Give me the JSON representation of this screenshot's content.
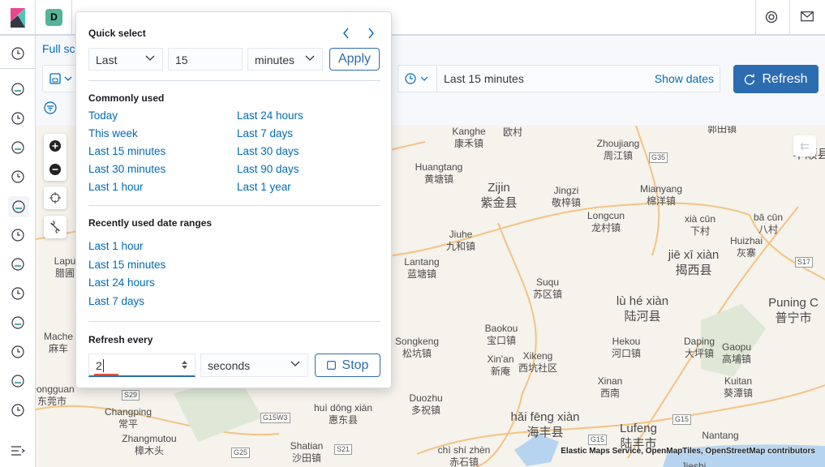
{
  "header": {
    "avatar_letter": "D",
    "help_icon": "help-lifebuoy-icon",
    "mail_icon": "mail-icon"
  },
  "sidebar": {
    "items": [
      "recently-viewed",
      "discover",
      "visualize",
      "dashboard",
      "canvas",
      "maps",
      "machine-learning",
      "metrics",
      "logs",
      "apm",
      "uptime",
      "graph",
      "dev-tools",
      "collapse"
    ]
  },
  "toolbar": {
    "full_screen": "Full screen",
    "date_text": "Last 15 minutes",
    "show_dates": "Show dates",
    "refresh_label": "Refresh"
  },
  "popover": {
    "quick_select": {
      "title": "Quick select",
      "direction": "Last",
      "value": "15",
      "unit": "minutes",
      "apply": "Apply"
    },
    "commonly_used": {
      "title": "Commonly used",
      "col1": [
        "Today",
        "This week",
        "Last 15 minutes",
        "Last 30 minutes",
        "Last 1 hour"
      ],
      "col2": [
        "Last 24 hours",
        "Last 7 days",
        "Last 30 days",
        "Last 90 days",
        "Last 1 year"
      ]
    },
    "recent": {
      "title": "Recently used date ranges",
      "items": [
        "Last 1 hour",
        "Last 15 minutes",
        "Last 24 hours",
        "Last 7 days"
      ]
    },
    "refresh": {
      "title": "Refresh every",
      "value": "2",
      "unit": "seconds",
      "stop": "Stop"
    }
  },
  "map": {
    "labels": [
      {
        "en": "Lapu",
        "zh": "腊圃"
      },
      {
        "en": "Mache",
        "zh": "麻车"
      },
      {
        "en": "Dongguan",
        "zh": "东莞市"
      },
      {
        "en": "Changping",
        "zh": "常平"
      },
      {
        "en": "Zhangmutou",
        "zh": "樟木头"
      },
      {
        "en": "huì dōng xiàn",
        "zh": "惠东县"
      },
      {
        "en": "Shatian",
        "zh": "沙田镇"
      },
      {
        "en": "Kanghe",
        "zh": "康禾镇"
      },
      {
        "en": "",
        "zh": "欧村"
      },
      {
        "en": "",
        "zh": "郭田镇"
      },
      {
        "en": "Zhoujiang",
        "zh": "周江镇"
      },
      {
        "en": "Huangtang",
        "zh": "黄塘镇"
      },
      {
        "en": "Zijin",
        "zh": "紫金县"
      },
      {
        "en": "Jingzi",
        "zh": "敬梓镇"
      },
      {
        "en": "Mianyang",
        "zh": "棉洋镇"
      },
      {
        "en": "Longcun",
        "zh": "龙村镇"
      },
      {
        "en": "xià cūn",
        "zh": "下村"
      },
      {
        "en": "bā cūn",
        "zh": "八村"
      },
      {
        "en": "Huizhai",
        "zh": "灰寨"
      },
      {
        "en": "jiē xī xiàn",
        "zh": "揭西县"
      },
      {
        "en": "Jiuhe",
        "zh": "九和镇"
      },
      {
        "en": "Lantang",
        "zh": "蓝塘镇"
      },
      {
        "en": "Suqu",
        "zh": "苏区镇"
      },
      {
        "en": "lù hé xiàn",
        "zh": "陆河县"
      },
      {
        "en": "Puning C",
        "zh": "普宁市"
      },
      {
        "en": "Baokou",
        "zh": "宝口镇"
      },
      {
        "en": "Songkeng",
        "zh": "松坑镇"
      },
      {
        "en": "Hekou",
        "zh": "河口镇"
      },
      {
        "en": "Daping",
        "zh": "大坪镇"
      },
      {
        "en": "Gaopu",
        "zh": "高埔镇"
      },
      {
        "en": "Xin'an",
        "zh": "新庵"
      },
      {
        "en": "Xikeng",
        "zh": "西坑社区"
      },
      {
        "en": "Xinan",
        "zh": "西南"
      },
      {
        "en": "Kuitan",
        "zh": "葵潭镇"
      },
      {
        "en": "Duozhu",
        "zh": "多祝镇"
      },
      {
        "en": "hǎi fēng xiàn",
        "zh": "海丰县"
      },
      {
        "en": "Lufeng",
        "zh": "陆丰市"
      },
      {
        "en": "Nantang",
        "zh": ""
      },
      {
        "en": "chì shí zhèn",
        "zh": "赤石镇"
      },
      {
        "en": "Jieshi",
        "zh": ""
      },
      {
        "en": "",
        "zh": "丰顺县"
      }
    ],
    "shields": [
      "G35",
      "S17",
      "G15",
      "G15",
      "S29",
      "G15W3",
      "G25",
      "S21"
    ],
    "attribution": "Elastic Maps Service, OpenMapTiles, OpenStreetMap contributors"
  },
  "colors": {
    "accent": "#2c6cb0",
    "link": "#006bb8",
    "map_bg": "#f6f2ec",
    "road": "#f3c383"
  }
}
